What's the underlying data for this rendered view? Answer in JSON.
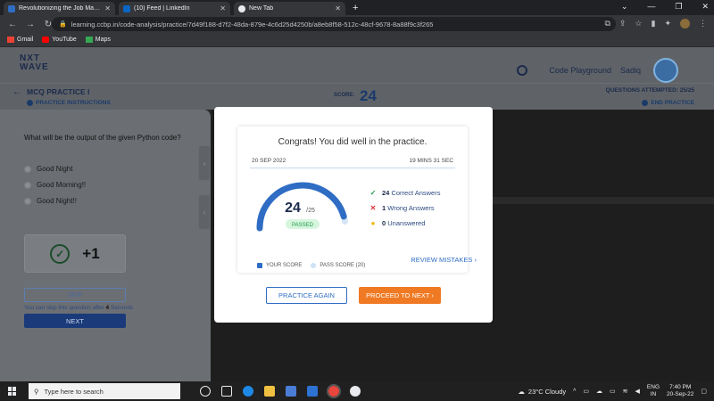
{
  "browser": {
    "tabs": [
      {
        "title": "Revolutionizing the Job Market |",
        "favicon_color": "#2f6dc4"
      },
      {
        "title": "(10) Feed | LinkedIn",
        "favicon_color": "#0a66c2"
      },
      {
        "title": "New Tab",
        "favicon_color": "#e8eaed"
      }
    ],
    "url": "learning.ccbp.in/code-analysis/practice/7d49f188-d7f2-48da-879e-4c6d25d4250b/a8eb8f58-512c-48cf-9678-8a88f9c3f265",
    "bookmarks": [
      {
        "label": "Gmail",
        "color": "#ea4335"
      },
      {
        "label": "YouTube",
        "color": "#ff0000"
      },
      {
        "label": "Maps",
        "color": "#34a853"
      }
    ]
  },
  "header": {
    "logo_line1": "NXT",
    "logo_line2": "WAVE",
    "code_playground": "Code Playground",
    "user_name": "Sadiq"
  },
  "subheader": {
    "title": "MCQ PRACTICE I",
    "instructions": "PRACTICE INSTRUCTIONS",
    "score_label": "SCORE:",
    "score_value": "24",
    "attempted": "QUESTIONS ATTEMPTED: 25/25",
    "end_practice": "END PRACTICE"
  },
  "question": {
    "text": "What will be the output of the given Python code?",
    "options": [
      "Good Night",
      "Good Morning!!",
      "Good Night!!"
    ],
    "points": "+1",
    "skip_label": "SKIP",
    "skip_note_prefix": "You can skip this question after ",
    "skip_note_count": "4",
    "skip_note_suffix": " Seconds",
    "next_label": "NEXT"
  },
  "modal": {
    "congrats": "Congrats! You did well in the practice.",
    "date": "20 SEP 2022",
    "duration": "19 MINS 31 SEC",
    "score": "24",
    "total": "/25",
    "status": "PASSED",
    "score_fraction": 0.96,
    "pass_fraction": 0.8,
    "correct_count": "24",
    "correct_label": "Correct Answers",
    "wrong_count": "1",
    "wrong_label": "Wrong Answers",
    "unanswered_count": "0",
    "unanswered_label": "Unanswered",
    "legend_your": "YOUR SCORE",
    "legend_pass": "PASS SCORE (20)",
    "review": "REVIEW MISTAKES",
    "practice_again": "PRACTICE AGAIN",
    "proceed": "PROCEED TO NEXT"
  },
  "colors": {
    "accent_blue": "#2f6dc4",
    "accent_orange": "#f07a24",
    "pass_green": "#d6f5dd",
    "correct_green": "#1e9b4a",
    "wrong_red": "#d33",
    "unanswered_yellow": "#f0b400"
  },
  "taskbar": {
    "search_placeholder": "Type here to search",
    "weather": "23°C  Cloudy",
    "lang1": "ENG",
    "lang2": "IN",
    "time": "7:40 PM",
    "date": "20-Sep-22"
  }
}
